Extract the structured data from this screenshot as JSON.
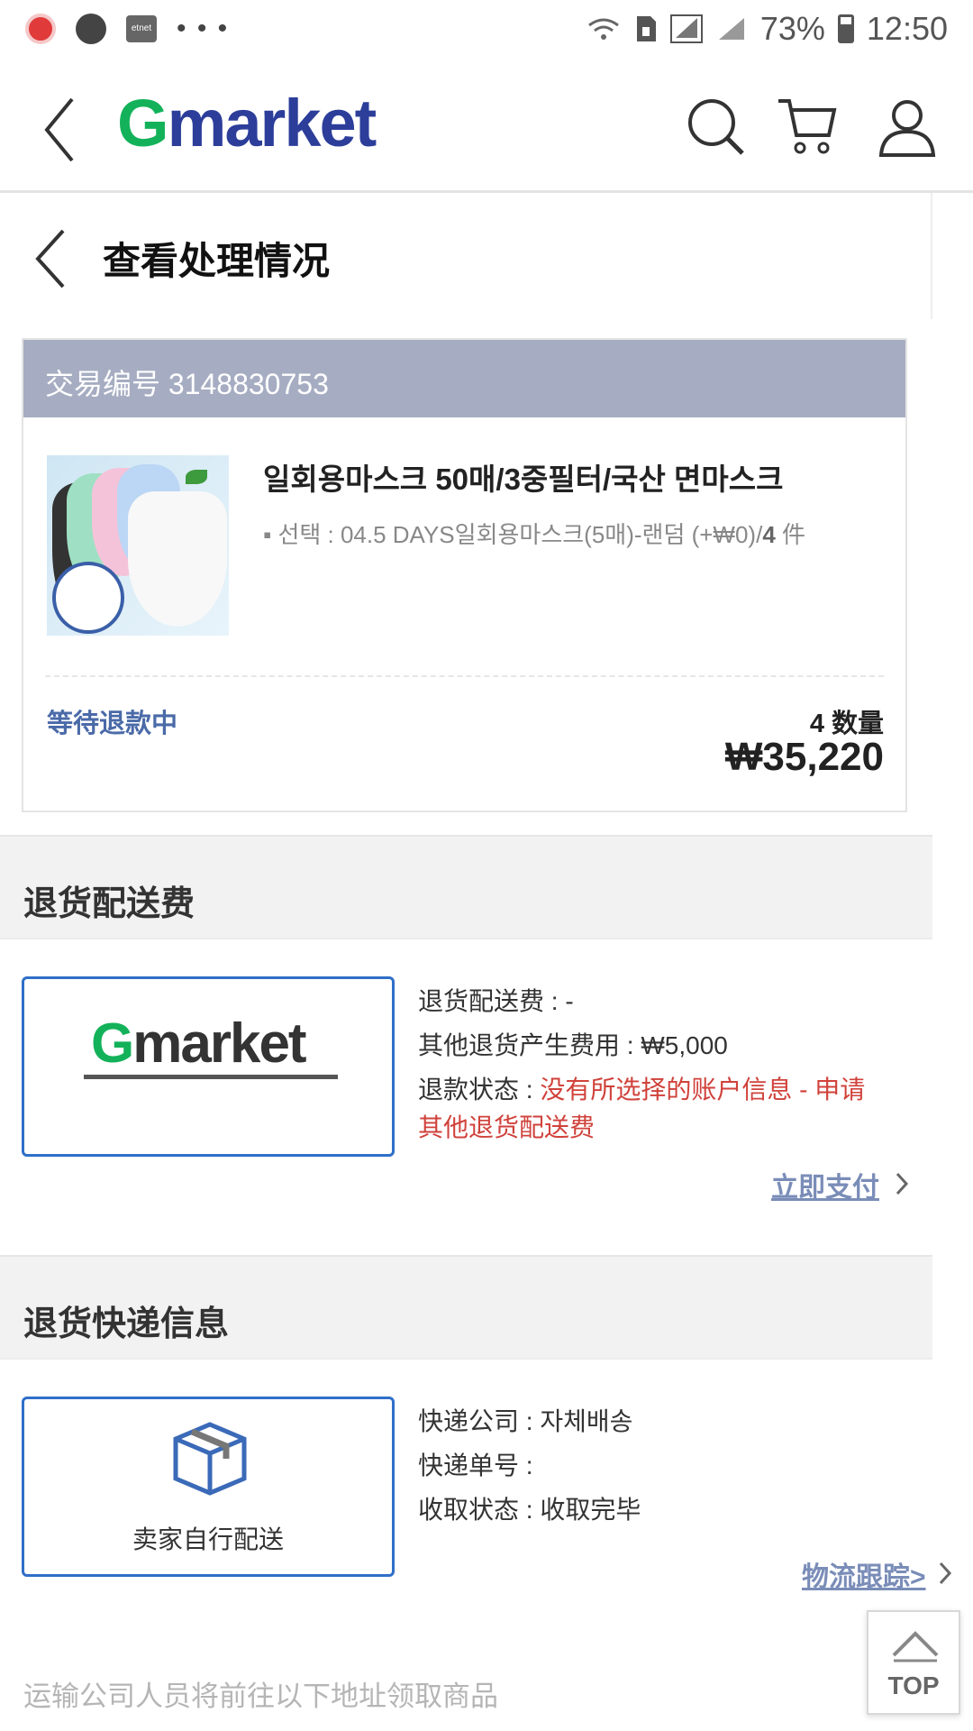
{
  "status_bar": {
    "left_icons": [
      "record-icon",
      "messenger-icon",
      "etnet-icon",
      "more-dots-icon"
    ],
    "etnet_label": "etnet",
    "dots": "• • •",
    "battery": "73%",
    "time": "12:50"
  },
  "header": {
    "logo_g": "G",
    "logo_rest": "market"
  },
  "sub_header": {
    "title": "查看处理情况"
  },
  "order": {
    "transaction_label": "交易编号 3148830753",
    "product_title": "일회용마스크 50매/3중필터/국산 면마스크",
    "option_prefix": "▪ 선택 : 04.5 DAYS일회용마스크(5매)-랜덤 (+₩0)/",
    "option_qty": "4",
    "option_unit": " 件",
    "status": "等待退款中",
    "qty_text": "4 数量",
    "price": "₩35,220"
  },
  "return_fee": {
    "section_title": "退货配送费",
    "logo_g": "G",
    "logo_rest": "market",
    "fee_line": "退货配送费 : -",
    "other_fee_line": "其他退货产生费用 : ₩5,000",
    "refund_label": "退款状态 : ",
    "refund_value_line1": "没有所选择的账户信息 - 申请",
    "refund_value_line2": "其他退货配送费",
    "pay_now_link": "立即支付"
  },
  "return_courier": {
    "section_title": "退货快递信息",
    "box_label": "卖家自行配送",
    "company_line": "快递公司 : 자체배송",
    "tracking_line": "快递单号 :",
    "pickup_line": "收取状态 : 收取完毕",
    "tracking_link": "物流跟踪>"
  },
  "footer_note": "运输公司人员将前往以下地址领取商品",
  "top_button": "TOP",
  "colors": {
    "brand_green": "#13b25a",
    "brand_navy": "#2c3e9a",
    "order_header_bg": "#a6adc2",
    "status_blue": "#4a6aa8",
    "error_red": "#d0423b",
    "box_border_blue": "#2f6fc9"
  }
}
